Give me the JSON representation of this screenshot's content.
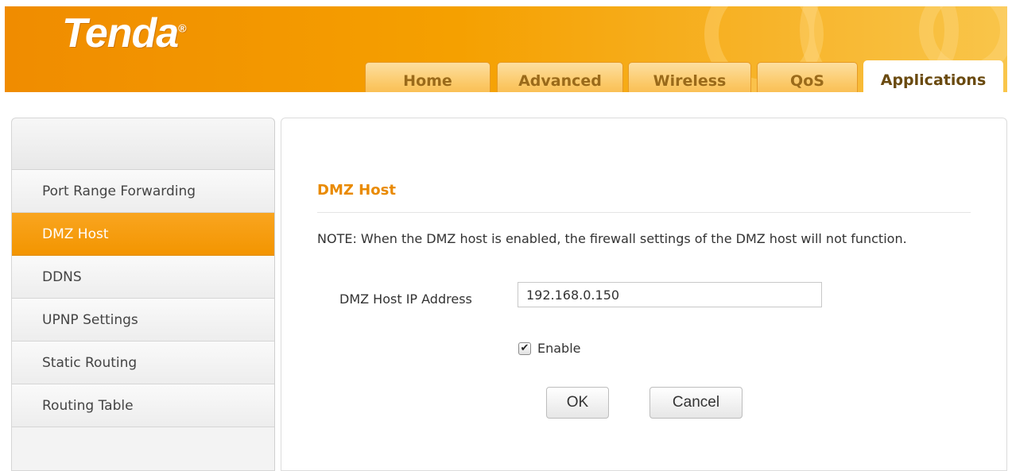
{
  "header": {
    "logo": "Tenda",
    "logo_mark": "®",
    "tabs": [
      {
        "label": "Home"
      },
      {
        "label": "Advanced"
      },
      {
        "label": "Wireless"
      },
      {
        "label": "QoS"
      },
      {
        "label": "Applications",
        "active": true
      }
    ]
  },
  "sidebar": {
    "items": [
      {
        "label": "Port Range Forwarding"
      },
      {
        "label": "DMZ Host",
        "active": true
      },
      {
        "label": "DDNS"
      },
      {
        "label": "UPNP Settings"
      },
      {
        "label": "Static Routing"
      },
      {
        "label": "Routing Table"
      }
    ]
  },
  "main": {
    "title": "DMZ Host",
    "note": "NOTE: When the DMZ host is enabled, the firewall settings of the DMZ host will not function.",
    "ip_label": "DMZ Host IP Address",
    "ip_value": "192.168.0.150",
    "enable_label": "Enable",
    "enable_checked": true,
    "ok_label": "OK",
    "cancel_label": "Cancel"
  },
  "colors": {
    "accent": "#f39500",
    "title": "#e98a00",
    "tab_text": "#9a6a1a"
  }
}
